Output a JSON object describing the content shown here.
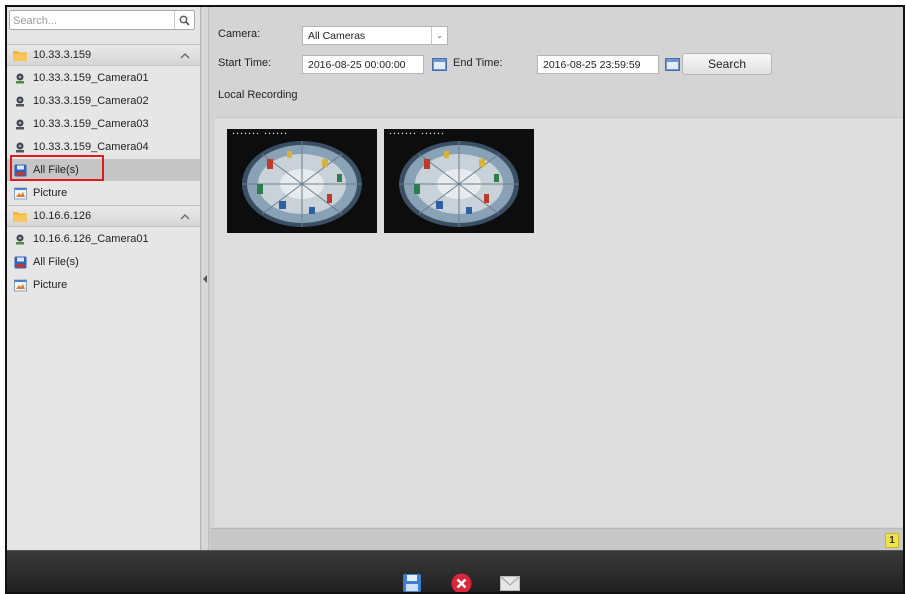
{
  "search": {
    "placeholder": "Search..."
  },
  "tree": {
    "group1": {
      "label": "10.33.3.159"
    },
    "group1_items": [
      {
        "label": "10.33.3.159_Camera01"
      },
      {
        "label": "10.33.3.159_Camera02"
      },
      {
        "label": "10.33.3.159_Camera03"
      },
      {
        "label": "10.33.3.159_Camera04"
      },
      {
        "label": "All File(s)"
      },
      {
        "label": "Picture"
      }
    ],
    "group2": {
      "label": "10.16.6.126"
    },
    "group2_items": [
      {
        "label": "10.16.6.126_Camera01"
      },
      {
        "label": "All File(s)"
      },
      {
        "label": "Picture"
      }
    ]
  },
  "filters": {
    "camera_label": "Camera:",
    "camera_value": "All Cameras",
    "start_label": "Start Time:",
    "start_value": "2016-08-25 00:00:00",
    "end_label": "End Time:",
    "end_value": "2016-08-25 23:59:59",
    "search_button": "Search"
  },
  "results": {
    "section_title": "Local Recording",
    "page_number": "1"
  },
  "colors": {
    "highlight": "#e01b1b",
    "page_badge": "#f1e24a"
  },
  "icons": {
    "search": "search-icon",
    "folder": "folder-icon",
    "camera": "camera-icon",
    "files": "all-files-icon",
    "picture": "picture-icon",
    "calendar": "calendar-icon",
    "save": "save-icon",
    "delete": "delete-icon",
    "email": "email-icon"
  }
}
